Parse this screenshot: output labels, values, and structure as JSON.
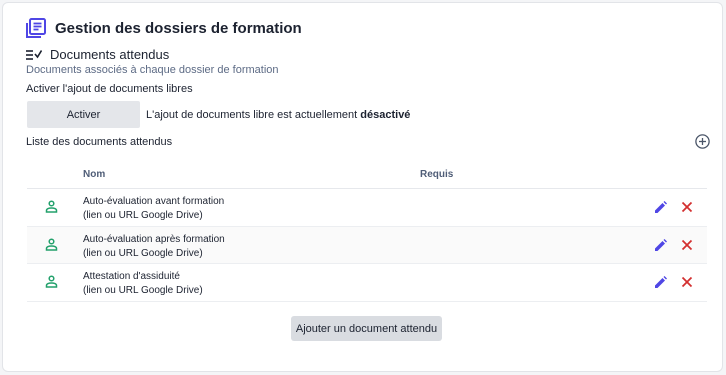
{
  "header": {
    "title": "Gestion des dossiers de formation",
    "icon": "article-icon",
    "icon_color": "#4f46e5"
  },
  "section": {
    "title": "Documents attendus",
    "subtitle": "Documents associés à chaque dossier de formation",
    "icon": "list-check-icon"
  },
  "free_docs": {
    "label": "Activer l'ajout de documents libres",
    "button_label": "Activer",
    "status_prefix": "L'ajout de documents libre est actuellement ",
    "status_value": "désactivé"
  },
  "list": {
    "title": "Liste des documents attendus",
    "add_icon": "plus-circle-icon",
    "columns": {
      "name": "Nom",
      "required": "Requis"
    },
    "rows": [
      {
        "line1": "Auto-évaluation avant formation",
        "line2": "(lien ou URL Google Drive)"
      },
      {
        "line1": "Auto-évaluation après formation",
        "line2": "(lien ou URL Google Drive)"
      },
      {
        "line1": "Attestation d'assiduité",
        "line2": "(lien ou URL Google Drive)"
      }
    ]
  },
  "add_button_label": "Ajouter un document attendu",
  "colors": {
    "accent": "#4f46e5",
    "person": "#22a06b",
    "delete": "#d32f2f"
  }
}
